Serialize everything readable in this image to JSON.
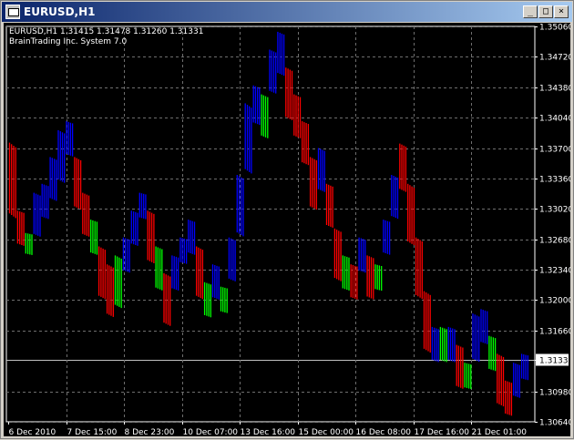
{
  "window": {
    "title": "EURUSD,H1",
    "buttons": {
      "minimize": "_",
      "maximize": "□",
      "close": "×"
    }
  },
  "info": {
    "line1": "EURUSD,H1  1.31415 1.31478 1.31260 1.31331",
    "line2": "BrainTrading Inc. System 7.0"
  },
  "colors": {
    "background": "#000000",
    "grid": "#6e6e6e",
    "up": "#0000ff",
    "down": "#ff0000",
    "neutral": "#00ff00",
    "text": "#ffffff"
  },
  "chart_data": {
    "type": "candlestick",
    "symbol": "EURUSD",
    "timeframe": "H1",
    "grid": true,
    "ylim": [
      1.3064,
      1.3506
    ],
    "y_ticks": [
      "1.35060",
      "1.34720",
      "1.34380",
      "1.34040",
      "1.33700",
      "1.33360",
      "1.33020",
      "1.32680",
      "1.32340",
      "1.32000",
      "1.31660",
      "1.31331",
      "1.30980",
      "1.30640"
    ],
    "current_price": "1.31331",
    "x_ticks": [
      "6 Dec 2010",
      "7 Dec 15:00",
      "8 Dec 23:00",
      "10 Dec 07:00",
      "13 Dec 16:00",
      "15 Dec 00:00",
      "16 Dec 08:00",
      "17 Dec 16:00",
      "21 Dec 01:00"
    ],
    "bars_approx": [
      [
        1.3365,
        1.3376,
        1.329,
        "down"
      ],
      [
        1.329,
        1.33,
        1.326,
        "down"
      ],
      [
        1.3262,
        1.3275,
        1.325,
        "neutral"
      ],
      [
        1.3275,
        1.332,
        1.327,
        "up"
      ],
      [
        1.331,
        1.333,
        1.329,
        "up"
      ],
      [
        1.333,
        1.336,
        1.331,
        "up"
      ],
      [
        1.336,
        1.339,
        1.333,
        "up"
      ],
      [
        1.338,
        1.34,
        1.336,
        "up"
      ],
      [
        1.334,
        1.336,
        1.33,
        "down"
      ],
      [
        1.33,
        1.332,
        1.327,
        "down"
      ],
      [
        1.327,
        1.329,
        1.325,
        "neutral"
      ],
      [
        1.325,
        1.326,
        1.32,
        "down"
      ],
      [
        1.322,
        1.324,
        1.318,
        "down"
      ],
      [
        1.323,
        1.325,
        1.319,
        "neutral"
      ],
      [
        1.324,
        1.327,
        1.323,
        "up"
      ],
      [
        1.327,
        1.33,
        1.326,
        "up"
      ],
      [
        1.33,
        1.332,
        1.329,
        "up"
      ],
      [
        1.329,
        1.33,
        1.324,
        "down"
      ],
      [
        1.324,
        1.326,
        1.321,
        "neutral"
      ],
      [
        1.32,
        1.323,
        1.317,
        "down"
      ],
      [
        1.322,
        1.325,
        1.321,
        "up"
      ],
      [
        1.325,
        1.327,
        1.324,
        "up"
      ],
      [
        1.326,
        1.329,
        1.325,
        "up"
      ],
      [
        1.323,
        1.326,
        1.32,
        "down"
      ],
      [
        1.32,
        1.322,
        1.318,
        "neutral"
      ],
      [
        1.321,
        1.324,
        1.32,
        "up"
      ],
      [
        1.32,
        1.3215,
        1.3185,
        "neutral"
      ],
      [
        1.323,
        1.327,
        1.322,
        "up"
      ],
      [
        1.328,
        1.334,
        1.327,
        "up"
      ],
      [
        1.335,
        1.342,
        1.334,
        "up"
      ],
      [
        1.341,
        1.344,
        1.3395,
        "up"
      ],
      [
        1.34,
        1.343,
        1.338,
        "neutral"
      ],
      [
        1.344,
        1.348,
        1.343,
        "up"
      ],
      [
        1.347,
        1.35,
        1.345,
        "up"
      ],
      [
        1.344,
        1.346,
        1.34,
        "down"
      ],
      [
        1.341,
        1.343,
        1.338,
        "down"
      ],
      [
        1.338,
        1.34,
        1.335,
        "down"
      ],
      [
        1.334,
        1.336,
        1.33,
        "down"
      ],
      [
        1.333,
        1.337,
        1.332,
        "up"
      ],
      [
        1.33,
        1.333,
        1.328,
        "down"
      ],
      [
        1.325,
        1.328,
        1.322,
        "down"
      ],
      [
        1.323,
        1.325,
        1.321,
        "neutral"
      ],
      [
        1.322,
        1.324,
        1.32,
        "down"
      ],
      [
        1.324,
        1.327,
        1.323,
        "up"
      ],
      [
        1.323,
        1.325,
        1.32,
        "down"
      ],
      [
        1.322,
        1.324,
        1.321,
        "neutral"
      ],
      [
        1.326,
        1.329,
        1.325,
        "up"
      ],
      [
        1.33,
        1.334,
        1.329,
        "up"
      ],
      [
        1.336,
        1.3375,
        1.332,
        "down"
      ],
      [
        1.33,
        1.333,
        1.326,
        "down"
      ],
      [
        1.326,
        1.327,
        1.32,
        "down"
      ],
      [
        1.319,
        1.321,
        1.314,
        "down"
      ],
      [
        1.315,
        1.317,
        1.313,
        "up"
      ],
      [
        1.316,
        1.317,
        1.313,
        "neutral"
      ],
      [
        1.314,
        1.317,
        1.313,
        "up"
      ],
      [
        1.313,
        1.315,
        1.31,
        "down"
      ],
      [
        1.311,
        1.313,
        1.31,
        "neutral"
      ],
      [
        1.314,
        1.3185,
        1.313,
        "up"
      ],
      [
        1.316,
        1.319,
        1.315,
        "up"
      ],
      [
        1.314,
        1.316,
        1.312,
        "neutral"
      ],
      [
        1.312,
        1.314,
        1.308,
        "down"
      ],
      [
        1.309,
        1.311,
        1.307,
        "down"
      ],
      [
        1.31,
        1.313,
        1.309,
        "up"
      ],
      [
        1.312,
        1.314,
        1.311,
        "up"
      ]
    ]
  }
}
